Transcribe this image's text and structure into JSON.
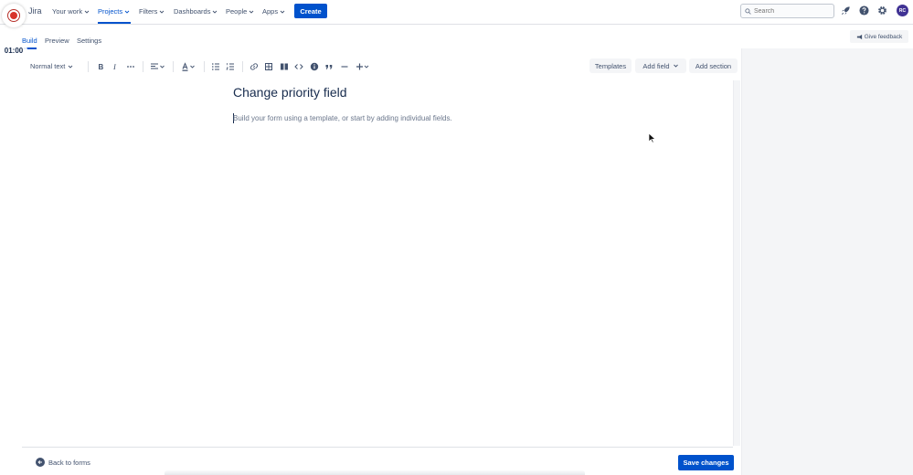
{
  "app": {
    "name": "Jira"
  },
  "nav": {
    "logo_text": "Jira",
    "items": [
      {
        "label": "Your work",
        "active": false
      },
      {
        "label": "Projects",
        "active": true
      },
      {
        "label": "Filters",
        "active": false
      },
      {
        "label": "Dashboards",
        "active": false
      },
      {
        "label": "People",
        "active": false
      },
      {
        "label": "Apps",
        "active": false
      }
    ],
    "create_label": "Create",
    "search_placeholder": "Search",
    "avatar_initials": "RC",
    "icons": [
      "rocket-icon",
      "help-icon",
      "settings-icon"
    ]
  },
  "recording": {
    "timer": "01:00"
  },
  "tabs": {
    "items": [
      {
        "label": "Build",
        "active": true
      },
      {
        "label": "Preview",
        "active": false
      },
      {
        "label": "Settings",
        "active": false
      }
    ],
    "feedback_label": "Give feedback"
  },
  "toolbar": {
    "text_style": "Normal text",
    "templates_label": "Templates",
    "add_field_label": "Add field",
    "add_section_label": "Add section"
  },
  "form": {
    "title": "Change priority field",
    "hint": "Build your form using a template, or start by adding individual fields."
  },
  "footer": {
    "back_label": "Back to forms",
    "save_label": "Save changes"
  },
  "colors": {
    "primary": "#0052cc",
    "text": "#172b4d",
    "subtle_text": "#42526e",
    "panel_bg": "#f4f5f7",
    "record_red": "#d8342b",
    "avatar_bg": "#403294"
  }
}
